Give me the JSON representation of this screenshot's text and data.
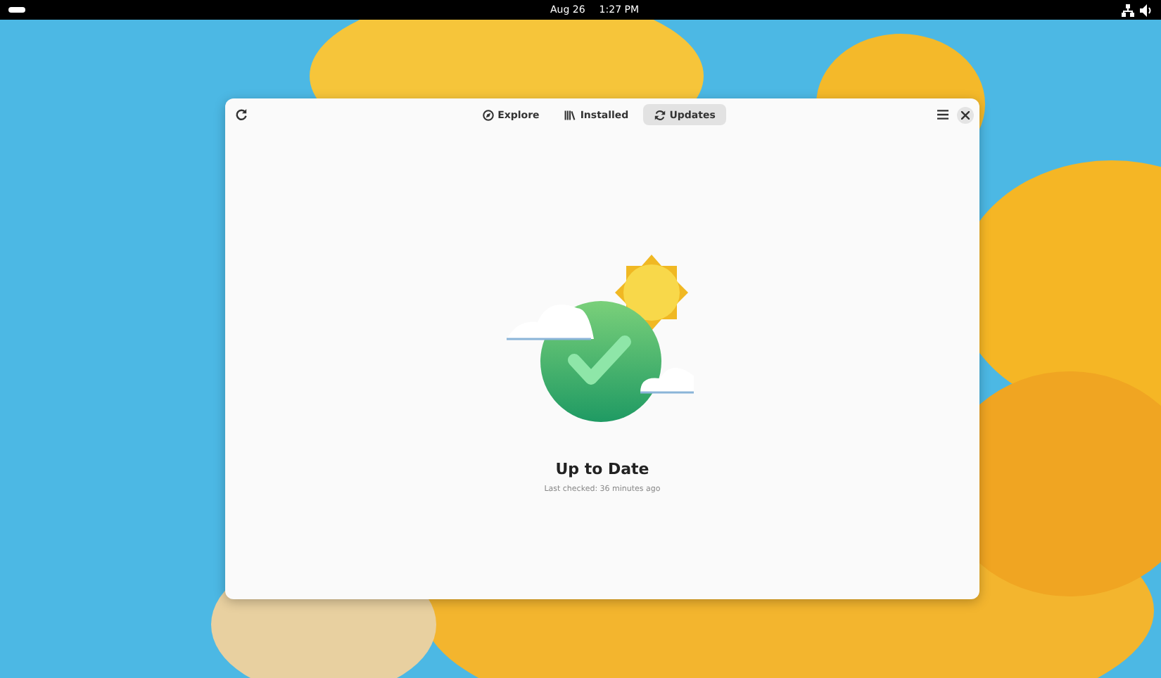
{
  "top_bar": {
    "date": "Aug 26",
    "time": "1:27 PM"
  },
  "tabs": [
    {
      "label": "Explore",
      "kind": "explore",
      "selected": false
    },
    {
      "label": "Installed",
      "kind": "installed",
      "selected": false
    },
    {
      "label": "Updates",
      "kind": "updates",
      "selected": true
    }
  ],
  "status": {
    "title": "Up to Date",
    "subtitle": "Last checked: 36 minutes ago"
  }
}
